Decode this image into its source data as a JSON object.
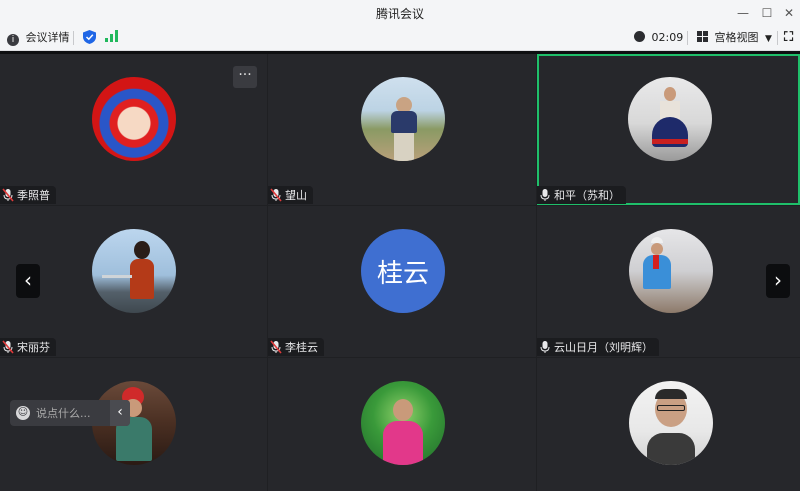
{
  "window": {
    "title": "腾讯会议"
  },
  "toolbar": {
    "meeting_info_label": "会议详情",
    "timer": "02:09",
    "layout_label": "宫格视图"
  },
  "participants": [
    {
      "name": "季照普",
      "mic": "muted",
      "avatar": "photo"
    },
    {
      "name": "望山",
      "mic": "muted",
      "avatar": "photo"
    },
    {
      "name": "和平（苏和）",
      "mic": "on",
      "avatar": "photo",
      "active_speaker": true
    },
    {
      "name": "宋丽芬",
      "mic": "muted",
      "avatar": "photo"
    },
    {
      "name": "李桂云",
      "mic": "muted",
      "avatar": "text",
      "avatar_text": "桂云"
    },
    {
      "name": "云山日月（刘明辉）",
      "mic": "on",
      "avatar": "photo"
    },
    {
      "name": "",
      "avatar": "photo"
    },
    {
      "name": "",
      "avatar": "photo"
    },
    {
      "name": "",
      "avatar": "photo"
    }
  ],
  "chat": {
    "placeholder": "说点什么..."
  },
  "colors": {
    "active_border": "#1fbf6a",
    "text_avatar_bg": "#3f6fd1",
    "tile_bg": "#26272b"
  }
}
